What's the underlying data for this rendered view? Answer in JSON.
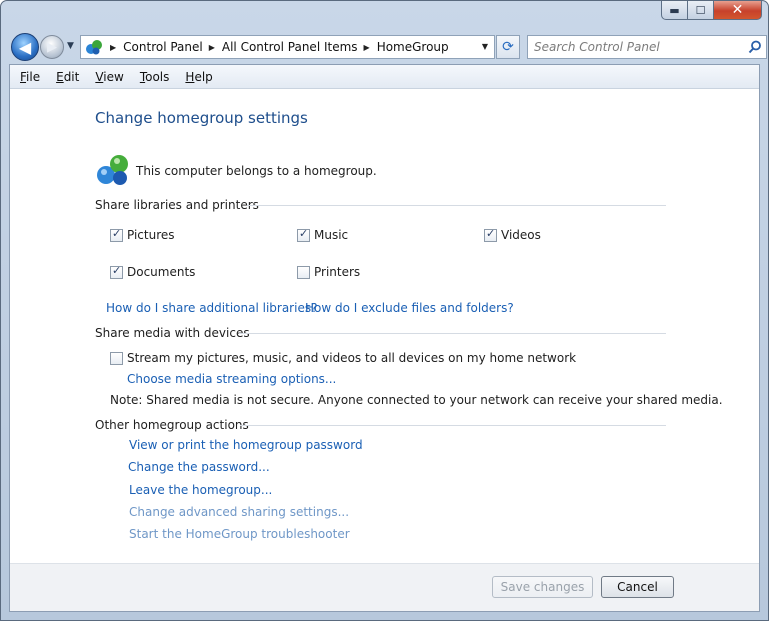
{
  "window": {
    "caption_buttons": {
      "minimize": "▬",
      "maximize": "☐",
      "close": "✕"
    }
  },
  "nav": {
    "back_glyph": "◀",
    "forward_glyph": "▶",
    "address_crumbs": [
      "Control Panel",
      "All Control Panel Items",
      "HomeGroup"
    ],
    "crumb_separator": "▶",
    "dropdown_glyph": "▼",
    "refresh_glyph": "⟳",
    "search_placeholder": "Search Control Panel"
  },
  "menubar": {
    "items": [
      {
        "underlined": "F",
        "rest": "ile"
      },
      {
        "underlined": "E",
        "rest": "dit"
      },
      {
        "underlined": "V",
        "rest": "iew"
      },
      {
        "underlined": "T",
        "rest": "ools"
      },
      {
        "underlined": "H",
        "rest": "elp"
      }
    ]
  },
  "main": {
    "title": "Change homegroup settings",
    "belongs_text": "This computer belongs to a homegroup.",
    "share_section": {
      "heading": "Share libraries and printers",
      "items": [
        {
          "label": "Pictures",
          "checked": true
        },
        {
          "label": "Music",
          "checked": true
        },
        {
          "label": "Videos",
          "checked": true
        },
        {
          "label": "Documents",
          "checked": true
        },
        {
          "label": "Printers",
          "checked": false
        }
      ],
      "links": [
        "How do I share additional libraries?",
        "How do I exclude files and folders?"
      ]
    },
    "media_section": {
      "heading": "Share media with devices",
      "stream_label": "Stream my pictures, music, and videos to all devices on my home network",
      "stream_checked": false,
      "options_link": "Choose media streaming options...",
      "note": "Note: Shared media is not secure. Anyone connected to your network can receive your shared media."
    },
    "actions_section": {
      "heading": "Other homegroup actions",
      "links": [
        "View or print the homegroup password",
        "Change the password...",
        "Leave the homegroup...",
        "Change advanced sharing settings...",
        "Start the HomeGroup troubleshooter"
      ]
    }
  },
  "footer": {
    "save_label": "Save changes",
    "cancel_label": "Cancel"
  },
  "colors": {
    "link": "#1a5fb4",
    "title": "#1e4e8c",
    "close_button": "#c7412b"
  }
}
